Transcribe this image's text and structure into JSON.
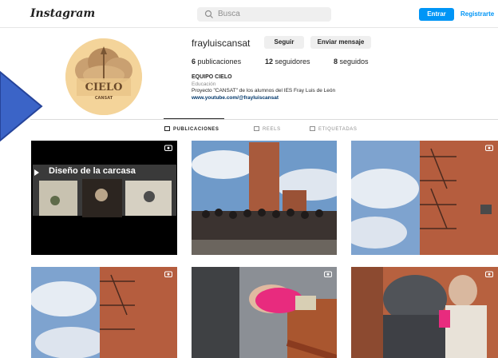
{
  "header": {
    "logo": "Instagram",
    "search_placeholder": "Busca",
    "login_label": "Entrar",
    "signup_label": "Registrarte"
  },
  "profile": {
    "username": "frayluiscansat",
    "follow_label": "Seguir",
    "message_label": "Enviar mensaje",
    "posts_count": "6",
    "posts_label": "publicaciones",
    "followers_count": "12",
    "followers_label": "seguidores",
    "following_count": "8",
    "following_label": "seguidos",
    "display_name": "EQUIPO CIELO",
    "category": "Educación",
    "bio": "Proyecto \"CANSAT\" de los alumnos del IES Fray Luis de León",
    "link": "www.youtube.com/@frayluiscansat",
    "avatar_text_main": "CIELO",
    "avatar_text_sub": "CANSAT"
  },
  "tabs": [
    {
      "label": "PUBLICACIONES",
      "active": true
    },
    {
      "label": "REELS",
      "active": false
    },
    {
      "label": "ETIQUETADAS",
      "active": false
    }
  ],
  "posts": [
    {
      "type": "reel",
      "caption": "Diseño de la carcasa"
    },
    {
      "type": "photo"
    },
    {
      "type": "photo"
    },
    {
      "type": "photo"
    },
    {
      "type": "photo"
    },
    {
      "type": "photo"
    }
  ],
  "colors": {
    "accent": "#0095f6",
    "avatar_bg": "#f3d7a0",
    "arrow": "#3b64c7"
  },
  "icons": [
    "search-icon",
    "grid-icon",
    "reels-icon",
    "tagged-icon",
    "reel-badge-icon",
    "arrow-shape"
  ]
}
